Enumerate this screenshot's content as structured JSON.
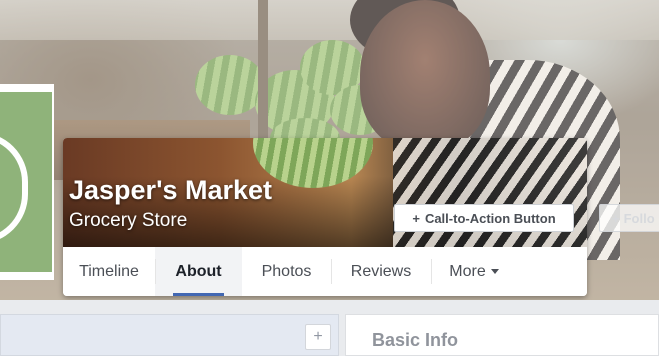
{
  "page": {
    "name": "Jasper's Market",
    "category": "Grocery Store"
  },
  "actions": {
    "cta_label": "Call-to-Action Button",
    "cta_icon": "plus-icon",
    "follow_label": "Follo"
  },
  "tabs": [
    {
      "label": "Timeline",
      "active": false
    },
    {
      "label": "About",
      "active": true
    },
    {
      "label": "Photos",
      "active": false
    },
    {
      "label": "Reviews",
      "active": false
    },
    {
      "label": "More",
      "active": false,
      "dropdown": true
    }
  ],
  "about": {
    "section_title": "Basic Info",
    "add_icon": "plus-icon"
  },
  "colors": {
    "accent": "#4267b2",
    "avatar_green": "#8fb37a",
    "tab_active_bg": "#f2f3f5",
    "page_bg": "#e9ebee"
  }
}
